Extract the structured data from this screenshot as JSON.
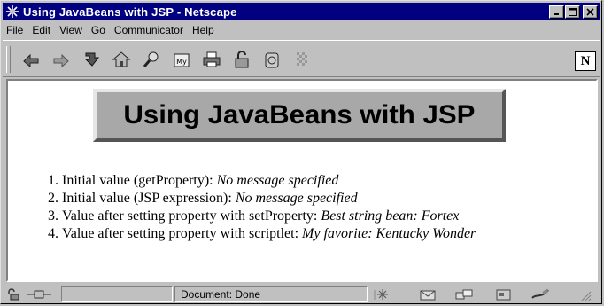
{
  "window": {
    "title": "Using JavaBeans with JSP - Netscape",
    "controls": {
      "minimize_icon": "minimize-icon",
      "maximize_icon": "maximize-icon",
      "close_icon": "close-icon"
    }
  },
  "menu": {
    "items": [
      {
        "label": "File"
      },
      {
        "label": "Edit"
      },
      {
        "label": "View"
      },
      {
        "label": "Go"
      },
      {
        "label": "Communicator"
      },
      {
        "label": "Help"
      }
    ]
  },
  "toolbar": {
    "buttons": [
      {
        "icon": "back-icon"
      },
      {
        "icon": "forward-icon"
      },
      {
        "icon": "reload-icon"
      },
      {
        "icon": "home-icon"
      },
      {
        "icon": "search-icon"
      },
      {
        "icon": "my-netscape-icon",
        "text": "My"
      },
      {
        "icon": "print-icon"
      },
      {
        "icon": "security-icon"
      },
      {
        "icon": "shop-icon"
      },
      {
        "icon": "stop-icon"
      }
    ],
    "logo_text": "N"
  },
  "page": {
    "heading": "Using JavaBeans with JSP",
    "list": [
      {
        "prefix": "Initial value (getProperty): ",
        "value": "No message specified"
      },
      {
        "prefix": "Initial value (JSP expression): ",
        "value": "No message specified"
      },
      {
        "prefix": "Value after setting property with setProperty: ",
        "value": "Best string bean: Fortex"
      },
      {
        "prefix": "Value after setting property with scriptlet: ",
        "value": "My favorite: Kentucky Wonder"
      }
    ]
  },
  "status": {
    "text": "Document: Done"
  },
  "colors": {
    "titlebar": "#000080",
    "chrome": "#c0c0c0",
    "heading_box": "#a8a8a8"
  }
}
